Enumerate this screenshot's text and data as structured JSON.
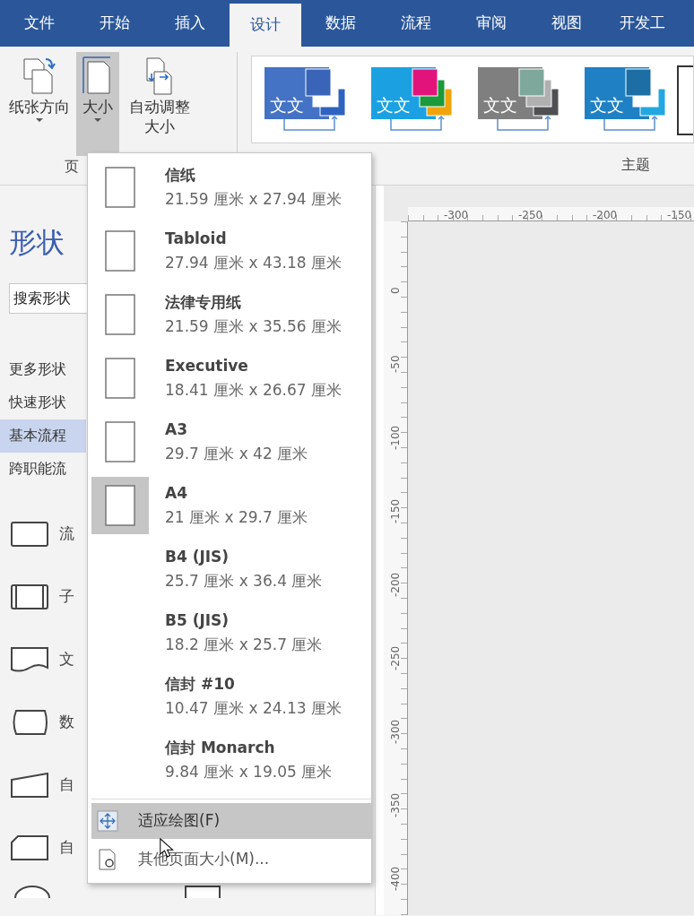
{
  "tabs": [
    {
      "label": "文件",
      "selected": false
    },
    {
      "label": "开始",
      "selected": false
    },
    {
      "label": "插入",
      "selected": false
    },
    {
      "label": "设计",
      "selected": true
    },
    {
      "label": "数据",
      "selected": false
    },
    {
      "label": "流程",
      "selected": false
    },
    {
      "label": "审阅",
      "selected": false
    },
    {
      "label": "视图",
      "selected": false
    },
    {
      "label": "开发工",
      "selected": false
    }
  ],
  "ribbon": {
    "page_setup": {
      "buttons": [
        {
          "label": "纸张方向",
          "kind": "orientation",
          "pressed": false,
          "caret": true
        },
        {
          "label": "大小",
          "kind": "size",
          "pressed": true,
          "caret": true
        },
        {
          "label": "自动调整大小",
          "kind": "autosize",
          "pressed": false,
          "caret": false
        }
      ],
      "group_label": "页"
    },
    "themes": {
      "items": [
        {
          "label": "文文",
          "color": "#4472c4"
        },
        {
          "label": "文文",
          "color": "#1ba1e2"
        },
        {
          "label": "文文",
          "color": "#7f7f7f"
        },
        {
          "label": "文文",
          "color": "#1f80c4"
        },
        {
          "color": "#ffffff"
        }
      ],
      "group_label": "主题"
    }
  },
  "shapes_pane": {
    "title": "形状",
    "search": {
      "placeholder": "搜索形状"
    },
    "stencils": [
      {
        "label": "更多形状",
        "selected": false
      },
      {
        "label": "快速形状",
        "selected": false
      },
      {
        "label": "基本流程",
        "selected": true
      },
      {
        "label": "跨职能流",
        "selected": false
      }
    ],
    "shapes": [
      {
        "label": "流",
        "kind": "process"
      },
      {
        "label": "子",
        "kind": "subprocess"
      },
      {
        "label": "文",
        "kind": "document"
      },
      {
        "label": "数",
        "kind": "data"
      },
      {
        "label": "自",
        "kind": "manual"
      },
      {
        "label": "自",
        "kind": "card"
      }
    ]
  },
  "size_menu": {
    "items": [
      {
        "name": "信纸",
        "dims": "21.59 厘米 x 27.94 厘米",
        "icon": true,
        "selected": false
      },
      {
        "name": "Tabloid",
        "dims": "27.94 厘米 x 43.18 厘米",
        "icon": true,
        "selected": false
      },
      {
        "name": "法律专用纸",
        "dims": "21.59 厘米 x 35.56 厘米",
        "icon": true,
        "selected": false
      },
      {
        "name": "Executive",
        "dims": "18.41 厘米 x 26.67 厘米",
        "icon": true,
        "selected": false
      },
      {
        "name": "A3",
        "dims": "29.7 厘米 x 42 厘米",
        "icon": true,
        "selected": false
      },
      {
        "name": "A4",
        "dims": "21 厘米 x 29.7 厘米",
        "icon": true,
        "selected": true
      },
      {
        "name": "B4 (JIS)",
        "dims": "25.7 厘米 x 36.4 厘米",
        "icon": false,
        "selected": false
      },
      {
        "name": "B5 (JIS)",
        "dims": "18.2 厘米 x 25.7 厘米",
        "icon": false,
        "selected": false
      },
      {
        "name": "信封 #10",
        "dims": "10.47 厘米 x 24.13 厘米",
        "icon": false,
        "selected": false
      },
      {
        "name": "信封 Monarch",
        "dims": "9.84 厘米 x 19.05 厘米",
        "icon": false,
        "selected": false
      }
    ],
    "commands": [
      {
        "label": "适应绘图(F)",
        "kind": "fit",
        "hovered": true
      },
      {
        "label": "其他页面大小(M)...",
        "kind": "more",
        "hovered": false
      }
    ]
  },
  "canvas": {
    "top_ruler": [
      "-300",
      "-250",
      "-200",
      "-150"
    ],
    "left_ruler": [
      "0",
      "-50",
      "-100",
      "-150",
      "-200",
      "-250",
      "-300",
      "-350",
      "-400"
    ]
  }
}
